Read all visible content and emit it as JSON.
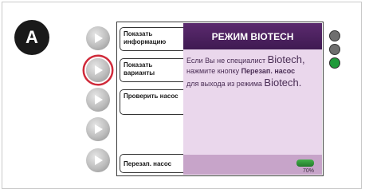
{
  "badge": {
    "letter": "A"
  },
  "tabs": [
    {
      "label": "Показать информацию"
    },
    {
      "label": "Показать варианты"
    },
    {
      "label": "Проверить насос"
    },
    {
      "label": "Перезап. насос"
    }
  ],
  "screen": {
    "title": "РЕЖИМ BIOTECH",
    "line1_a": "Если Вы не специалист ",
    "line1_b": "Biotech,",
    "line2_a": "нажмите кнопку ",
    "line2_b": "Перезап. насос",
    "line3_a": "для выхода из режима ",
    "line3_b": "Biotech.",
    "battery_percent": "70%"
  },
  "leds": {
    "colors": [
      "#6e6e6e",
      "#6e6e6e",
      "#1f9a3a"
    ]
  },
  "colors": {
    "highlight": "#d02a3a",
    "title_bar": "#4a1f5e",
    "screen_bg": "#ead7ec"
  }
}
